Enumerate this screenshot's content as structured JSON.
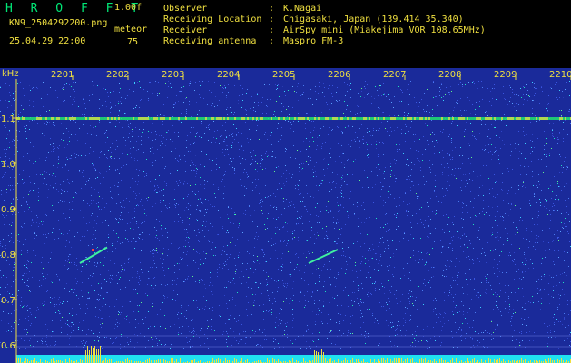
{
  "header": {
    "app_title": "H R O F F T",
    "version": "1.00f",
    "filename": "KN9_2504292200.png",
    "datetime": "25.04.29 22:00",
    "meteor_label": "meteor",
    "meteor_count": "75"
  },
  "meta": {
    "rows": [
      {
        "key": "Observer",
        "value": "K.Nagai"
      },
      {
        "key": "Receiving Location",
        "value": "Chigasaki, Japan (139.414 35.340)"
      },
      {
        "key": "Receiver",
        "value": "AirSpy mini (Miakejima VOR 108.65MHz)"
      },
      {
        "key": "Receiving antenna",
        "value": "Maspro FM-3"
      }
    ]
  },
  "spectrogram": {
    "unit_label": "kHz",
    "y_ticks": [
      "1.1",
      "1.0",
      "0.9",
      "0.8",
      "0.7",
      "0.6"
    ],
    "time_ticks": [
      "2201",
      "2202",
      "2203",
      "2204",
      "2205",
      "2206",
      "2207",
      "2208",
      "2209",
      "2210"
    ],
    "colors": {
      "background": "#1a2a9a",
      "axis_text": "#f0e040",
      "carrier_line": "#20e070",
      "bottom_bar": "#20e0f0",
      "spikes": "#f0e040"
    }
  }
}
